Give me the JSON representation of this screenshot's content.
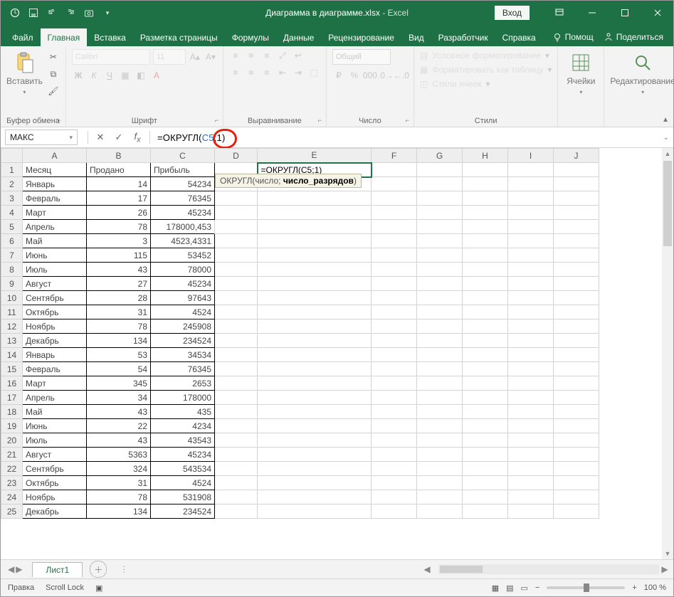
{
  "title": {
    "doc": "Диаграмма в диаграмме.xlsx",
    "app": "Excel",
    "sep": "  -  "
  },
  "signin": "Вход",
  "tabs": [
    "Файл",
    "Главная",
    "Вставка",
    "Разметка страницы",
    "Формулы",
    "Данные",
    "Рецензирование",
    "Вид",
    "Разработчик",
    "Справка"
  ],
  "tabs_right": {
    "tell": "Помощ",
    "share": "Поделиться"
  },
  "ribbon": {
    "clipboard": {
      "paste": "Вставить",
      "label": "Буфер обмена"
    },
    "font": {
      "label": "Шрифт",
      "name": "Calibri",
      "size": "11"
    },
    "align": {
      "label": "Выравнивание"
    },
    "number": {
      "label": "Число",
      "format": "Общий"
    },
    "styles": {
      "label": "Стили",
      "cond": "Условное форматирование",
      "table": "Форматировать как таблицу",
      "cell": "Стили ячеек"
    },
    "cells": {
      "label": "Ячейки"
    },
    "editing": {
      "label": "Редактирование"
    }
  },
  "namebox": "МАКС",
  "formula": {
    "raw": "=ОКРУГЛ(C5;1)",
    "fn": "=ОКРУГЛ(",
    "ref": "C5",
    "tail": ";1)"
  },
  "tooltip": {
    "fn": "ОКРУГЛ(",
    "a1": "число; ",
    "a2": "число_разрядов",
    ")": ")"
  },
  "edit_cell_text": "=ОКРУГЛ(C5;1)",
  "columns": [
    "A",
    "B",
    "C",
    "D",
    "E",
    "F",
    "G",
    "H",
    "I",
    "J"
  ],
  "headers": {
    "A": "Месяц",
    "B": "Продано",
    "C": "Прибыль"
  },
  "rows": [
    {
      "n": 2,
      "a": "Январь",
      "b": "14",
      "c": "54234"
    },
    {
      "n": 3,
      "a": "Февраль",
      "b": "17",
      "c": "76345"
    },
    {
      "n": 4,
      "a": "Март",
      "b": "26",
      "c": "45234"
    },
    {
      "n": 5,
      "a": "Апрель",
      "b": "78",
      "c": "178000,453"
    },
    {
      "n": 6,
      "a": "Май",
      "b": "3",
      "c": "4523,4331"
    },
    {
      "n": 7,
      "a": "Июнь",
      "b": "115",
      "c": "53452"
    },
    {
      "n": 8,
      "a": "Июль",
      "b": "43",
      "c": "78000"
    },
    {
      "n": 9,
      "a": "Август",
      "b": "27",
      "c": "45234"
    },
    {
      "n": 10,
      "a": "Сентябрь",
      "b": "28",
      "c": "97643"
    },
    {
      "n": 11,
      "a": "Октябрь",
      "b": "31",
      "c": "4524"
    },
    {
      "n": 12,
      "a": "Ноябрь",
      "b": "78",
      "c": "245908"
    },
    {
      "n": 13,
      "a": "Декабрь",
      "b": "134",
      "c": "234524"
    },
    {
      "n": 14,
      "a": "Январь",
      "b": "53",
      "c": "34534"
    },
    {
      "n": 15,
      "a": "Февраль",
      "b": "54",
      "c": "76345"
    },
    {
      "n": 16,
      "a": "Март",
      "b": "345",
      "c": "2653"
    },
    {
      "n": 17,
      "a": "Апрель",
      "b": "34",
      "c": "178000"
    },
    {
      "n": 18,
      "a": "Май",
      "b": "43",
      "c": "435"
    },
    {
      "n": 19,
      "a": "Июнь",
      "b": "22",
      "c": "4234"
    },
    {
      "n": 20,
      "a": "Июль",
      "b": "43",
      "c": "43543"
    },
    {
      "n": 21,
      "a": "Август",
      "b": "5363",
      "c": "45234"
    },
    {
      "n": 22,
      "a": "Сентябрь",
      "b": "324",
      "c": "543534"
    },
    {
      "n": 23,
      "a": "Октябрь",
      "b": "31",
      "c": "4524"
    },
    {
      "n": 24,
      "a": "Ноябрь",
      "b": "78",
      "c": "531908"
    },
    {
      "n": 25,
      "a": "Декабрь",
      "b": "134",
      "c": "234524"
    }
  ],
  "sheet": "Лист1",
  "status": {
    "mode": "Правка",
    "scroll": "Scroll Lock",
    "zoom": "100 %"
  }
}
